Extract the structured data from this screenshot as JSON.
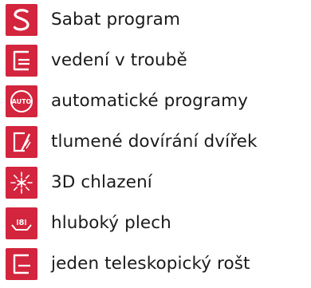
{
  "colors": {
    "badge": "#d3253d",
    "icon": "#ffffff",
    "text": "#1a1a1a"
  },
  "features": [
    {
      "icon": "sabbath-s-icon",
      "label": "Sabat program"
    },
    {
      "icon": "oven-guide-icon",
      "label": "vedení v troubě"
    },
    {
      "icon": "auto-programs-icon",
      "label": "automatické programy",
      "icon_text": "AUTO"
    },
    {
      "icon": "soft-close-door-icon",
      "label": "tlumené dovírání dvířek"
    },
    {
      "icon": "3d-cooling-icon",
      "label": "3D chlazení"
    },
    {
      "icon": "deep-tray-icon",
      "label": "hluboký plech",
      "icon_text": "8"
    },
    {
      "icon": "telescopic-rail-icon",
      "label": "jeden teleskopický rošt"
    }
  ]
}
